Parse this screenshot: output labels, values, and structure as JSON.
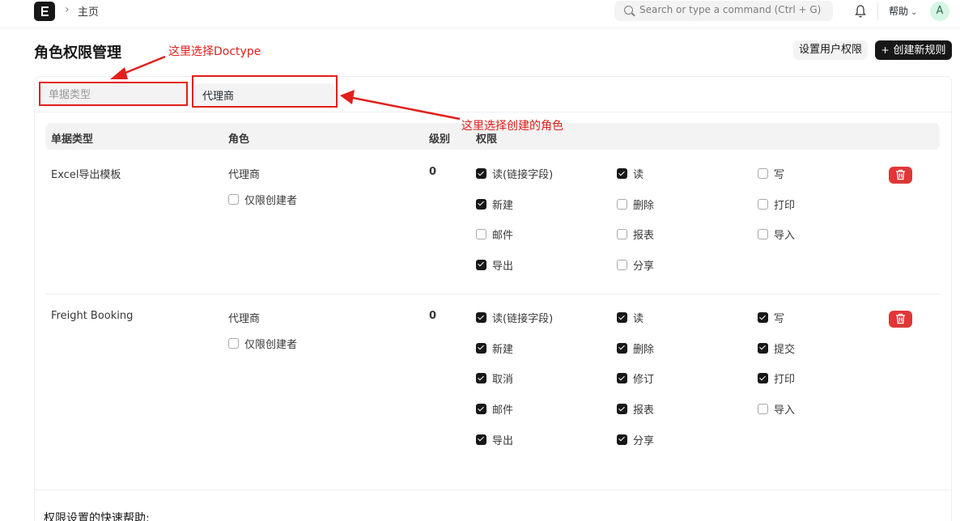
{
  "navbar": {
    "breadcrumb": "主页",
    "search_placeholder": "Search or type a command (Ctrl + G)",
    "help_label": "帮助",
    "avatar_letter": "A"
  },
  "page": {
    "title": "角色权限管理",
    "set_user_perm_label": "设置用户权限",
    "add_rule_label": "创建新规则"
  },
  "filters": {
    "doctype_placeholder": "单据类型",
    "role_value": "代理商"
  },
  "table": {
    "headers": {
      "doctype": "单据类型",
      "role": "角色",
      "level": "级别",
      "permissions": "权限"
    },
    "rows": [
      {
        "doctype": "Excel导出模板",
        "role": "代理商",
        "owner_only_label": "仅限创建者",
        "level": "0",
        "perms": [
          {
            "label": "读(链接字段)",
            "checked": true
          },
          {
            "label": "读",
            "checked": true
          },
          {
            "label": "写",
            "checked": false
          },
          {
            "label": "新建",
            "checked": true
          },
          {
            "label": "删除",
            "checked": false
          },
          {
            "label": "打印",
            "checked": false
          },
          {
            "label": "邮件",
            "checked": false
          },
          {
            "label": "报表",
            "checked": false
          },
          {
            "label": "导入",
            "checked": false
          },
          {
            "label": "导出",
            "checked": true
          },
          {
            "label": "分享",
            "checked": false
          }
        ]
      },
      {
        "doctype": "Freight Booking",
        "role": "代理商",
        "owner_only_label": "仅限创建者",
        "level": "0",
        "perms": [
          {
            "label": "读(链接字段)",
            "checked": true
          },
          {
            "label": "读",
            "checked": true
          },
          {
            "label": "写",
            "checked": true
          },
          {
            "label": "新建",
            "checked": true
          },
          {
            "label": "删除",
            "checked": true
          },
          {
            "label": "提交",
            "checked": true
          },
          {
            "label": "取消",
            "checked": true
          },
          {
            "label": "修订",
            "checked": true
          },
          {
            "label": "打印",
            "checked": true
          },
          {
            "label": "邮件",
            "checked": true
          },
          {
            "label": "报表",
            "checked": true
          },
          {
            "label": "导入",
            "checked": false
          },
          {
            "label": "导出",
            "checked": true
          },
          {
            "label": "分享",
            "checked": true
          }
        ]
      }
    ]
  },
  "help_section_title": "权限设置的快速帮助:",
  "annotations": {
    "doctype_note": "这里选择Doctype",
    "role_note": "这里选择创建的角色",
    "color": "#e0201b"
  }
}
